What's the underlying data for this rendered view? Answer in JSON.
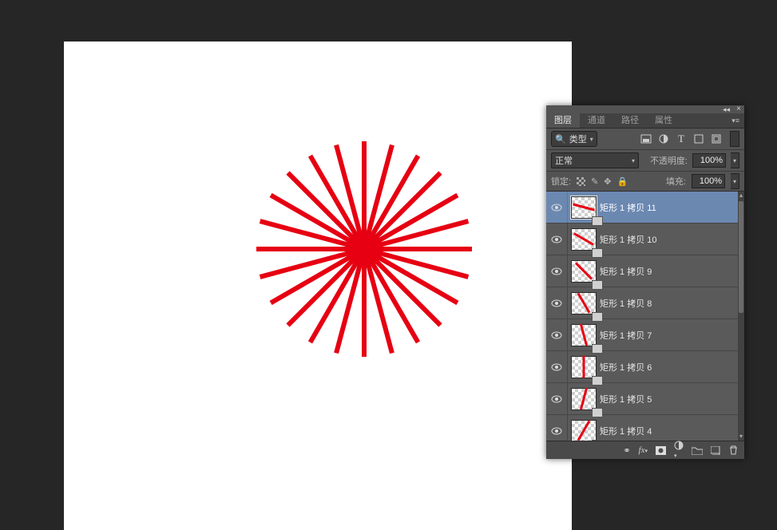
{
  "canvas": {
    "shape": {
      "type": "radial-lines",
      "color": "#e60012",
      "count": 12,
      "length": 270,
      "thickness": 6
    }
  },
  "panel": {
    "tabs": [
      {
        "label": "图层",
        "active": true
      },
      {
        "label": "通道",
        "active": false
      },
      {
        "label": "路径",
        "active": false
      },
      {
        "label": "属性",
        "active": false
      }
    ],
    "filter": {
      "search_icon": "🔍",
      "type_label": "类型"
    },
    "blend": {
      "mode": "正常",
      "opacity_label": "不透明度:",
      "opacity": "100%"
    },
    "lock": {
      "label": "锁定:",
      "fill_label": "填充:",
      "fill": "100%"
    },
    "layers": [
      {
        "name": "矩形 1 拷贝 11",
        "selected": true,
        "angle": 165
      },
      {
        "name": "矩形 1 拷贝 10",
        "selected": false,
        "angle": 150
      },
      {
        "name": "矩形 1 拷贝 9",
        "selected": false,
        "angle": 135
      },
      {
        "name": "矩形 1 拷贝 8",
        "selected": false,
        "angle": 120
      },
      {
        "name": "矩形 1 拷贝 7",
        "selected": false,
        "angle": 105
      },
      {
        "name": "矩形 1 拷贝 6",
        "selected": false,
        "angle": 90
      },
      {
        "name": "矩形 1 拷贝 5",
        "selected": false,
        "angle": 75
      },
      {
        "name": "矩形 1 拷贝 4",
        "selected": false,
        "angle": 60
      }
    ]
  }
}
